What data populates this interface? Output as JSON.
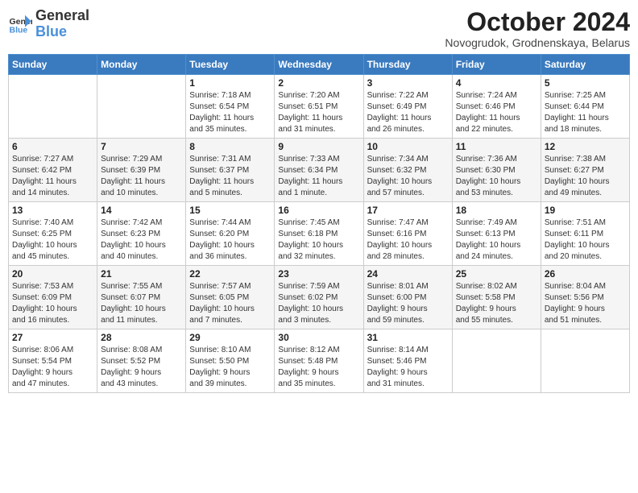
{
  "logo": {
    "line1": "General",
    "line2": "Blue"
  },
  "header": {
    "month": "October 2024",
    "location": "Novogrudok, Grodnenskaya, Belarus"
  },
  "weekdays": [
    "Sunday",
    "Monday",
    "Tuesday",
    "Wednesday",
    "Thursday",
    "Friday",
    "Saturday"
  ],
  "weeks": [
    [
      {
        "day": "",
        "info": ""
      },
      {
        "day": "",
        "info": ""
      },
      {
        "day": "1",
        "info": "Sunrise: 7:18 AM\nSunset: 6:54 PM\nDaylight: 11 hours\nand 35 minutes."
      },
      {
        "day": "2",
        "info": "Sunrise: 7:20 AM\nSunset: 6:51 PM\nDaylight: 11 hours\nand 31 minutes."
      },
      {
        "day": "3",
        "info": "Sunrise: 7:22 AM\nSunset: 6:49 PM\nDaylight: 11 hours\nand 26 minutes."
      },
      {
        "day": "4",
        "info": "Sunrise: 7:24 AM\nSunset: 6:46 PM\nDaylight: 11 hours\nand 22 minutes."
      },
      {
        "day": "5",
        "info": "Sunrise: 7:25 AM\nSunset: 6:44 PM\nDaylight: 11 hours\nand 18 minutes."
      }
    ],
    [
      {
        "day": "6",
        "info": "Sunrise: 7:27 AM\nSunset: 6:42 PM\nDaylight: 11 hours\nand 14 minutes."
      },
      {
        "day": "7",
        "info": "Sunrise: 7:29 AM\nSunset: 6:39 PM\nDaylight: 11 hours\nand 10 minutes."
      },
      {
        "day": "8",
        "info": "Sunrise: 7:31 AM\nSunset: 6:37 PM\nDaylight: 11 hours\nand 5 minutes."
      },
      {
        "day": "9",
        "info": "Sunrise: 7:33 AM\nSunset: 6:34 PM\nDaylight: 11 hours\nand 1 minute."
      },
      {
        "day": "10",
        "info": "Sunrise: 7:34 AM\nSunset: 6:32 PM\nDaylight: 10 hours\nand 57 minutes."
      },
      {
        "day": "11",
        "info": "Sunrise: 7:36 AM\nSunset: 6:30 PM\nDaylight: 10 hours\nand 53 minutes."
      },
      {
        "day": "12",
        "info": "Sunrise: 7:38 AM\nSunset: 6:27 PM\nDaylight: 10 hours\nand 49 minutes."
      }
    ],
    [
      {
        "day": "13",
        "info": "Sunrise: 7:40 AM\nSunset: 6:25 PM\nDaylight: 10 hours\nand 45 minutes."
      },
      {
        "day": "14",
        "info": "Sunrise: 7:42 AM\nSunset: 6:23 PM\nDaylight: 10 hours\nand 40 minutes."
      },
      {
        "day": "15",
        "info": "Sunrise: 7:44 AM\nSunset: 6:20 PM\nDaylight: 10 hours\nand 36 minutes."
      },
      {
        "day": "16",
        "info": "Sunrise: 7:45 AM\nSunset: 6:18 PM\nDaylight: 10 hours\nand 32 minutes."
      },
      {
        "day": "17",
        "info": "Sunrise: 7:47 AM\nSunset: 6:16 PM\nDaylight: 10 hours\nand 28 minutes."
      },
      {
        "day": "18",
        "info": "Sunrise: 7:49 AM\nSunset: 6:13 PM\nDaylight: 10 hours\nand 24 minutes."
      },
      {
        "day": "19",
        "info": "Sunrise: 7:51 AM\nSunset: 6:11 PM\nDaylight: 10 hours\nand 20 minutes."
      }
    ],
    [
      {
        "day": "20",
        "info": "Sunrise: 7:53 AM\nSunset: 6:09 PM\nDaylight: 10 hours\nand 16 minutes."
      },
      {
        "day": "21",
        "info": "Sunrise: 7:55 AM\nSunset: 6:07 PM\nDaylight: 10 hours\nand 11 minutes."
      },
      {
        "day": "22",
        "info": "Sunrise: 7:57 AM\nSunset: 6:05 PM\nDaylight: 10 hours\nand 7 minutes."
      },
      {
        "day": "23",
        "info": "Sunrise: 7:59 AM\nSunset: 6:02 PM\nDaylight: 10 hours\nand 3 minutes."
      },
      {
        "day": "24",
        "info": "Sunrise: 8:01 AM\nSunset: 6:00 PM\nDaylight: 9 hours\nand 59 minutes."
      },
      {
        "day": "25",
        "info": "Sunrise: 8:02 AM\nSunset: 5:58 PM\nDaylight: 9 hours\nand 55 minutes."
      },
      {
        "day": "26",
        "info": "Sunrise: 8:04 AM\nSunset: 5:56 PM\nDaylight: 9 hours\nand 51 minutes."
      }
    ],
    [
      {
        "day": "27",
        "info": "Sunrise: 8:06 AM\nSunset: 5:54 PM\nDaylight: 9 hours\nand 47 minutes."
      },
      {
        "day": "28",
        "info": "Sunrise: 8:08 AM\nSunset: 5:52 PM\nDaylight: 9 hours\nand 43 minutes."
      },
      {
        "day": "29",
        "info": "Sunrise: 8:10 AM\nSunset: 5:50 PM\nDaylight: 9 hours\nand 39 minutes."
      },
      {
        "day": "30",
        "info": "Sunrise: 8:12 AM\nSunset: 5:48 PM\nDaylight: 9 hours\nand 35 minutes."
      },
      {
        "day": "31",
        "info": "Sunrise: 8:14 AM\nSunset: 5:46 PM\nDaylight: 9 hours\nand 31 minutes."
      },
      {
        "day": "",
        "info": ""
      },
      {
        "day": "",
        "info": ""
      }
    ]
  ]
}
